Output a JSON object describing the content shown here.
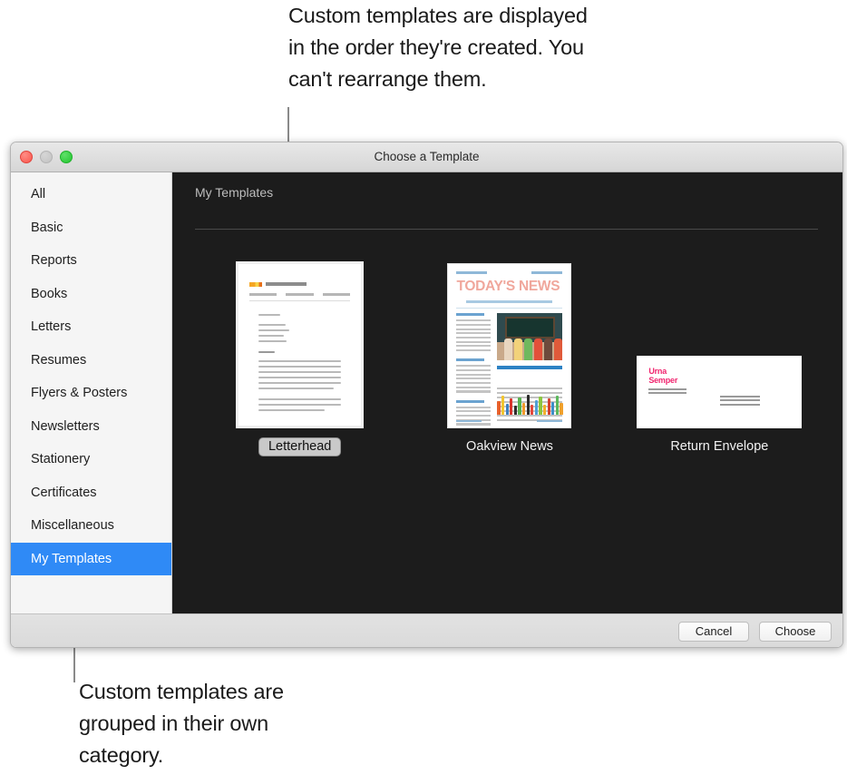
{
  "annotations": {
    "top": "Custom templates are displayed in the order they're created. You can't rearrange them.",
    "bottom": "Custom templates are grouped in their own category."
  },
  "window": {
    "title": "Choose a Template",
    "traffic_lights": {
      "close": "close-button",
      "minimize": "minimize-button",
      "maximize": "maximize-button"
    }
  },
  "sidebar": {
    "items": [
      {
        "label": "All",
        "selected": false
      },
      {
        "label": "Basic",
        "selected": false
      },
      {
        "label": "Reports",
        "selected": false
      },
      {
        "label": "Books",
        "selected": false
      },
      {
        "label": "Letters",
        "selected": false
      },
      {
        "label": "Resumes",
        "selected": false
      },
      {
        "label": "Flyers & Posters",
        "selected": false
      },
      {
        "label": "Newsletters",
        "selected": false
      },
      {
        "label": "Stationery",
        "selected": false
      },
      {
        "label": "Certificates",
        "selected": false
      },
      {
        "label": "Miscellaneous",
        "selected": false
      },
      {
        "label": "My Templates",
        "selected": true
      }
    ],
    "selected_color": "#2f8af6"
  },
  "content": {
    "section_header": "My Templates",
    "background": "#1c1c1c",
    "templates": [
      {
        "name": "Letterhead",
        "editing": true,
        "kind": "letterhead"
      },
      {
        "name": "Oakview News",
        "editing": false,
        "kind": "newsletter"
      },
      {
        "name": "Return Envelope",
        "editing": false,
        "kind": "envelope"
      }
    ]
  },
  "thumbnails": {
    "letterhead": {
      "logo_colors": [
        "#f5a623",
        "#f8d347",
        "#e8711a"
      ]
    },
    "newsletter": {
      "masthead": "TODAY'S NEWS",
      "masthead_color": "#f0a79c",
      "accent_color": "#2d82c4"
    },
    "envelope": {
      "logo_line1": "Urna",
      "logo_line2": "Semper",
      "logo_color": "#f0246e"
    }
  },
  "footer": {
    "cancel_label": "Cancel",
    "choose_label": "Choose"
  }
}
